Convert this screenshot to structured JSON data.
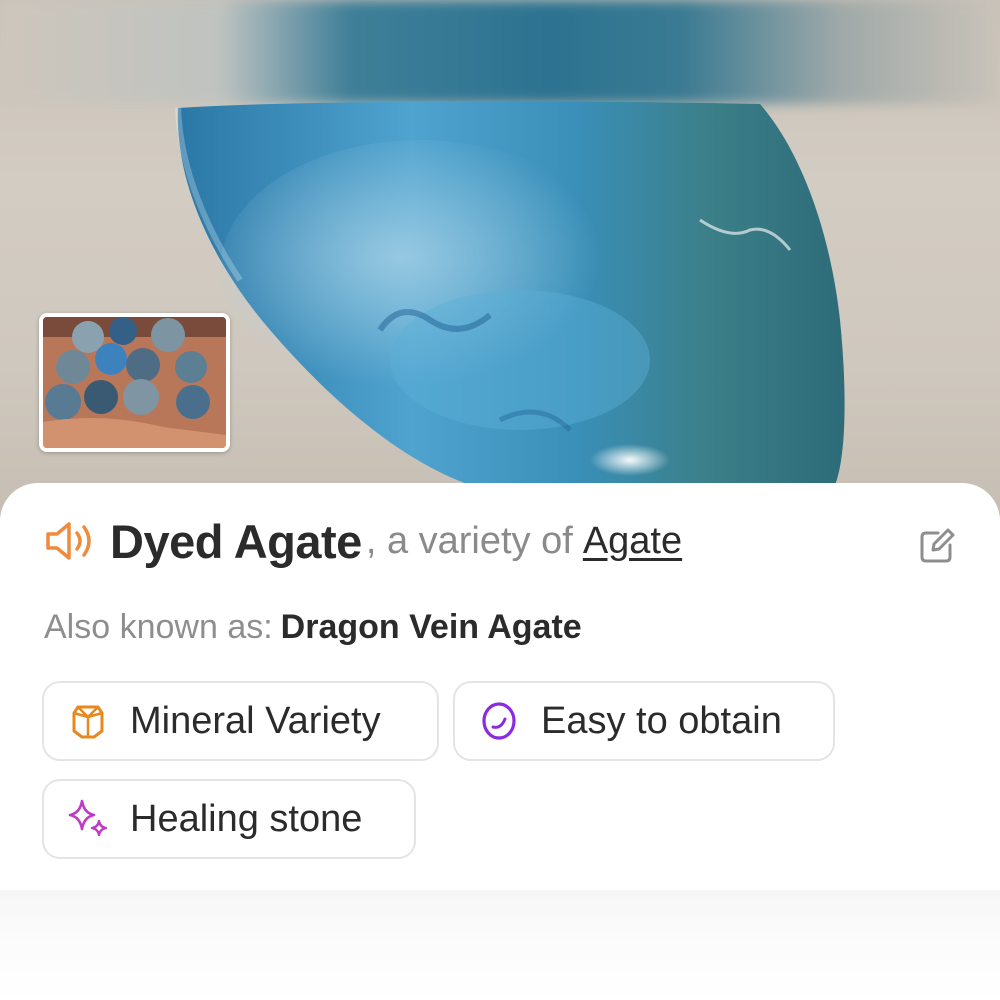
{
  "photo": {
    "subject": "blue-agate-stone-photo",
    "thumbnail": "beads-in-hand-thumbnail"
  },
  "header": {
    "speaker_icon": "speaker-icon",
    "name": "Dyed Agate",
    "separator": ", a variety of",
    "parent_link": "Agate",
    "edit_icon": "edit-icon"
  },
  "aka": {
    "label": "Also known as:",
    "value": "Dragon Vein Agate"
  },
  "chips": [
    {
      "label": "Mineral Variety",
      "icon": "gem-icon",
      "color": "#e8891e"
    },
    {
      "label": "Easy to obtain",
      "icon": "egg-icon",
      "color": "#8a2be2"
    },
    {
      "label": "Healing stone",
      "icon": "sparkle-icon",
      "color": "#c03bc4"
    }
  ],
  "colors": {
    "accent_orange": "#f08a3c",
    "text_dark": "#2b2b2b",
    "text_muted": "#8e8e8e"
  }
}
